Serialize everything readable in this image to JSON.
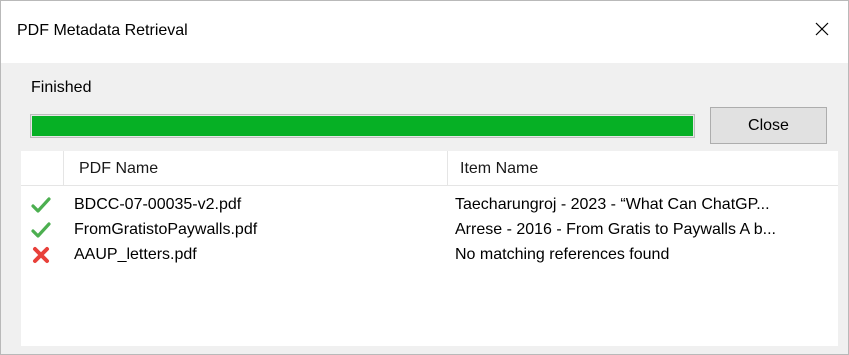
{
  "window": {
    "title": "PDF Metadata Retrieval",
    "close_icon": "close-icon"
  },
  "status_text": "Finished",
  "progress": {
    "value_percent": 100,
    "color": "#06b025"
  },
  "close_button_label": "Close",
  "table": {
    "columns": [
      "PDF Name",
      "Item Name"
    ],
    "rows": [
      {
        "status": "success",
        "icon": "checkmark-icon",
        "pdf_name": "BDCC-07-00035-v2.pdf",
        "item_name": "Taecharungroj - 2023 - “What Can ChatGP..."
      },
      {
        "status": "success",
        "icon": "checkmark-icon",
        "pdf_name": "FromGratistoPaywalls.pdf",
        "item_name": "Arrese - 2016 - From Gratis to Paywalls A b..."
      },
      {
        "status": "failure",
        "icon": "cross-icon",
        "pdf_name": "AAUP_letters.pdf",
        "item_name": "No matching references found"
      }
    ]
  },
  "colors": {
    "success": "#4caf50",
    "failure": "#e8403a"
  }
}
